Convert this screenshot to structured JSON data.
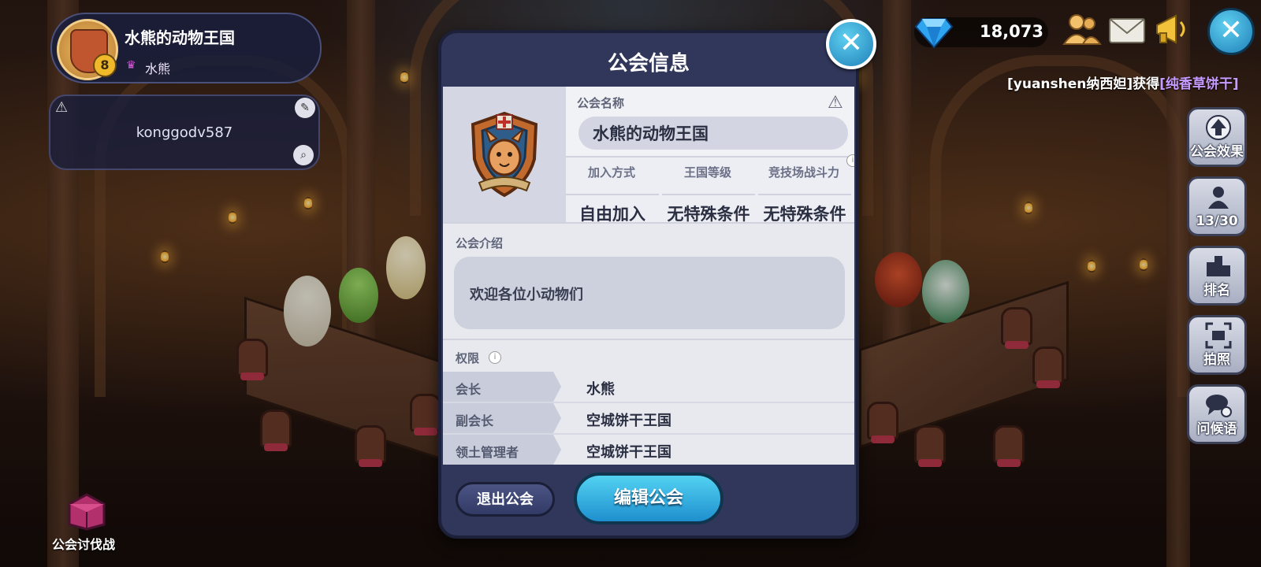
{
  "guild": {
    "name": "水熊的动物王国",
    "level": "8",
    "leader": "水熊",
    "notice": "konggodv587"
  },
  "raid": {
    "label": "公会讨伐战"
  },
  "currency": {
    "gems": "18,073"
  },
  "ticker": {
    "prefix": "[yuanshen纳西妲]获得",
    "item": "[纯香草饼干]"
  },
  "side_menu": [
    {
      "label": "公会效果",
      "icon": "guild-effect-icon"
    },
    {
      "label": "13/30",
      "icon": "member-icon"
    },
    {
      "label": "排名",
      "icon": "ranking-icon"
    },
    {
      "label": "拍照",
      "icon": "camera-icon"
    },
    {
      "label": "问候语",
      "icon": "greeting-icon"
    }
  ],
  "modal": {
    "title": "公会信息",
    "name_label": "公会名称",
    "name_value": "水熊的动物王国",
    "columns": [
      {
        "header": "加入方式",
        "value": "自由加入"
      },
      {
        "header": "王国等级",
        "value": "无特殊条件"
      },
      {
        "header": "竞技场战斗力",
        "value": "无特殊条件"
      }
    ],
    "intro_label": "公会介绍",
    "intro_text": "欢迎各位小动物们",
    "perm_label": "权限",
    "permissions": [
      {
        "role": "会长",
        "name": "水熊"
      },
      {
        "role": "副会长",
        "name": "空城饼干王国"
      },
      {
        "role": "领土管理者",
        "name": "空城饼干王国"
      }
    ],
    "quit_label": "退出公会",
    "edit_label": "编辑公会"
  },
  "colors": {
    "accent": "#1f8fce",
    "panel": "#31375a",
    "highlight": "#c79bff"
  }
}
